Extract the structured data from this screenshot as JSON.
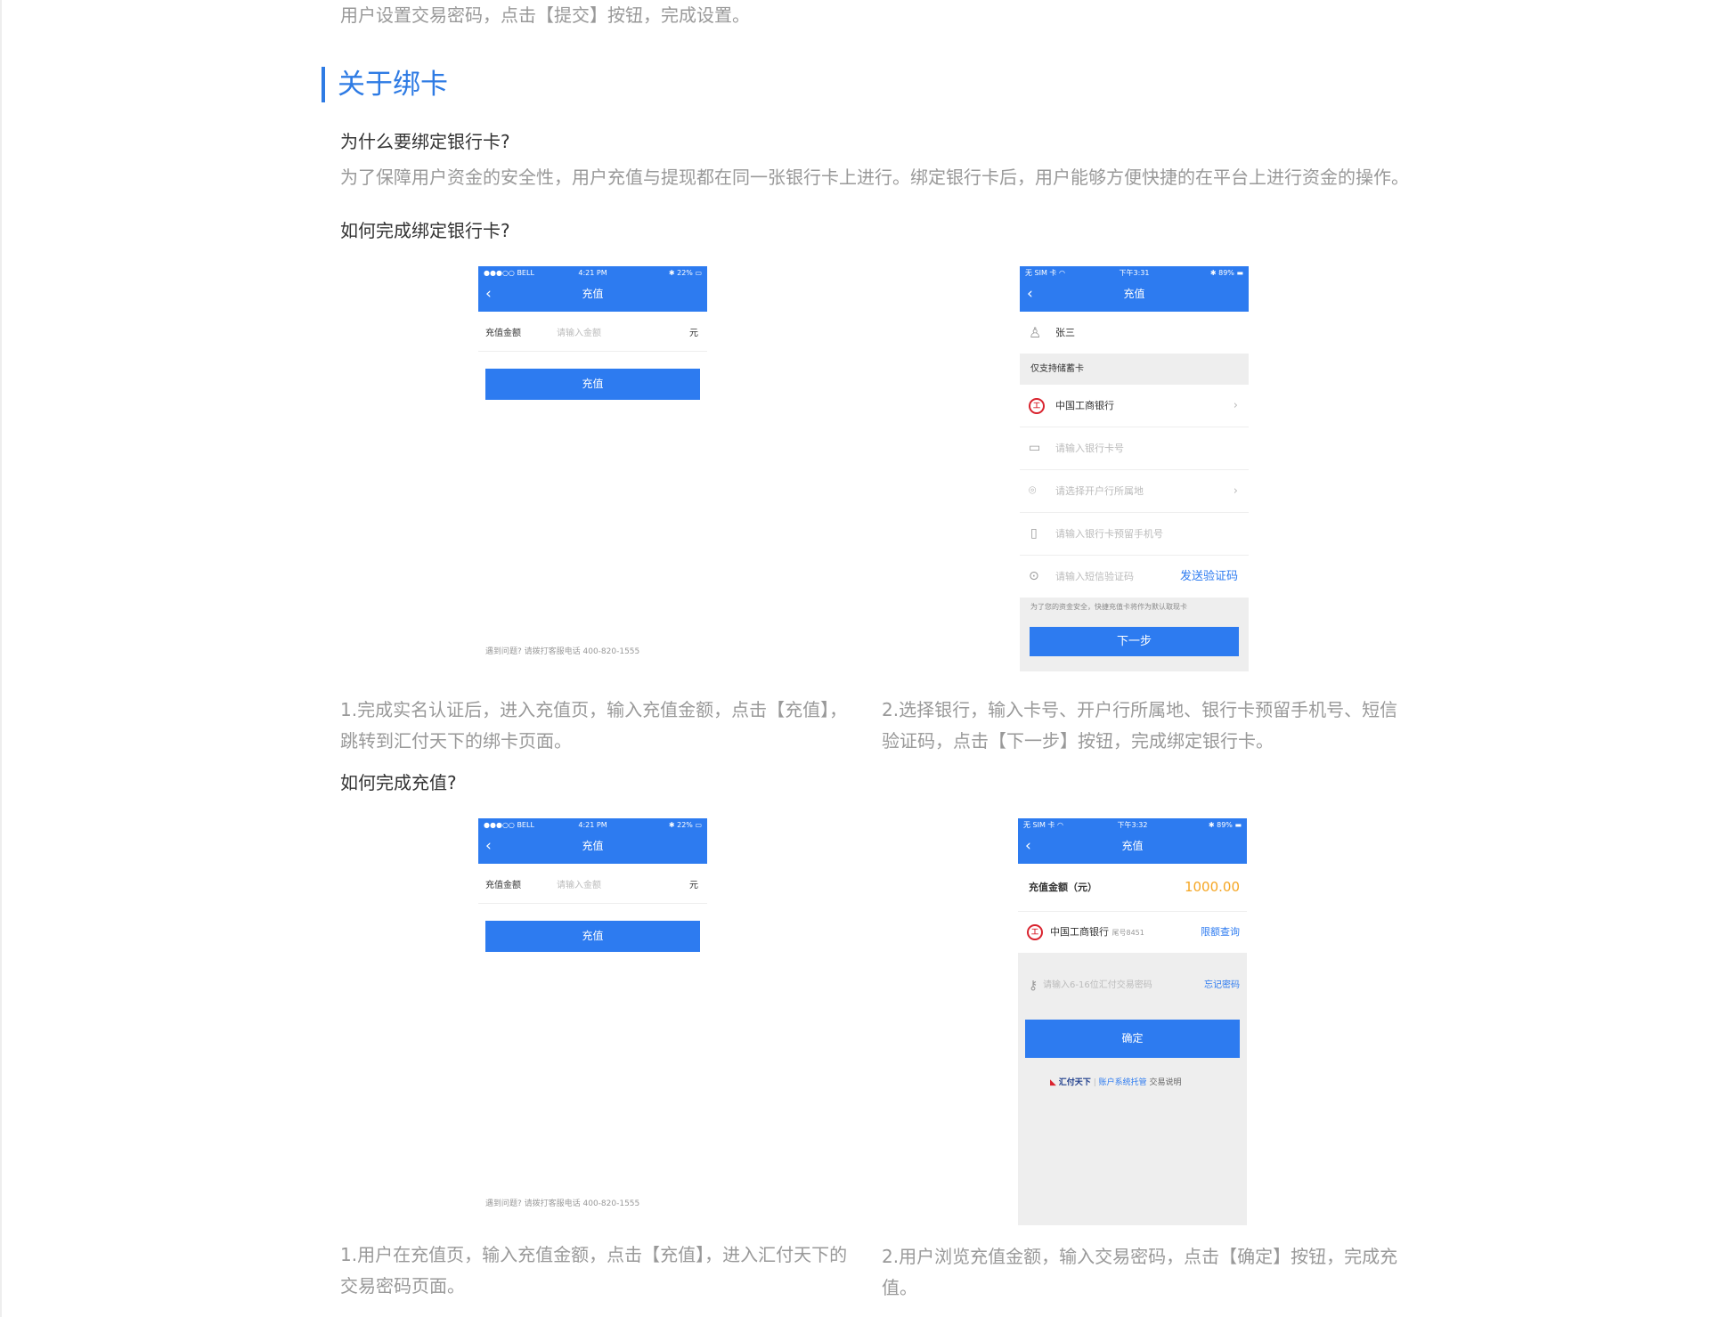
{
  "intro_text": "用户设置交易密码，点击【提交】按钮，完成设置。",
  "section_title": "关于绑卡",
  "q1": "为什么要绑定银行卡?",
  "a1": "为了保障用户资金的安全性，用户充值与提现都在同一张银行卡上进行。绑定银行卡后，用户能够方便快捷的在平台上进行资金的操作。",
  "q2": "如何完成绑定银行卡?",
  "q3": "如何完成充值?",
  "cap1": "1.完成实名认证后，进入充值页，输入充值金额，点击【充值】，跳转到汇付天下的绑卡页面。",
  "cap2": "2.选择银行，输入卡号、开户行所属地、银行卡预留手机号、短信验证码，点击【下一步】按钮，完成绑定银行卡。",
  "cap3": "1.用户在充值页，输入充值金额，点击【充值】，进入汇付天下的交易密码页面。",
  "cap4": "2.用户浏览充值金额，输入交易密码，点击【确定】按钮，完成充值。",
  "phoneA": {
    "status_left": "●●●○○ BELL",
    "status_time": "4:21 PM",
    "status_right": "22%",
    "title": "充值",
    "field_label": "充值金额",
    "field_placeholder": "请输入金额",
    "unit": "元",
    "button": "充值",
    "footer": "遇到问题? 请拨打客服电话 400-820-1555"
  },
  "phoneB": {
    "status_left": "无 SIM 卡",
    "status_time": "下午3:31",
    "status_right": "89%",
    "title": "充值",
    "user_name": "张三",
    "notice": "仅支持储蓄卡",
    "bank": "中国工商银行",
    "card_placeholder": "请输入银行卡号",
    "location_placeholder": "请选择开户行所属地",
    "phone_placeholder": "请输入银行卡预留手机号",
    "sms_placeholder": "请输入短信验证码",
    "sms_button": "发送验证码",
    "safety_note": "为了您的资金安全，快捷充值卡将作为默认取现卡",
    "next_button": "下一步"
  },
  "phoneC": {
    "status_left": "●●●○○ BELL",
    "status_time": "4:21 PM",
    "status_right": "22%",
    "title": "充值",
    "field_label": "充值金额",
    "field_placeholder": "请输入金额",
    "unit": "元",
    "button": "充值",
    "footer": "遇到问题? 请拨打客服电话 400-820-1555"
  },
  "phoneD": {
    "status_left": "无 SIM 卡",
    "status_time": "下午3:32",
    "status_right": "89%",
    "title": "充值",
    "amount_label": "充值金额（元）",
    "amount_value": "1000.00",
    "bank": "中国工商银行",
    "card_tail": "尾号8451",
    "limit_link": "限额查询",
    "password_placeholder": "请输入6-16位汇付交易密码",
    "forgot_link": "忘记密码",
    "confirm_button": "确定",
    "brand": "汇付天下",
    "brand_tagline": "账户系统托管",
    "brand_link": "交易说明"
  },
  "colors": {
    "accent": "#2e7be4",
    "nav": "#2d7bf0",
    "amount": "#f5a623",
    "bank_red": "#d9232e"
  }
}
